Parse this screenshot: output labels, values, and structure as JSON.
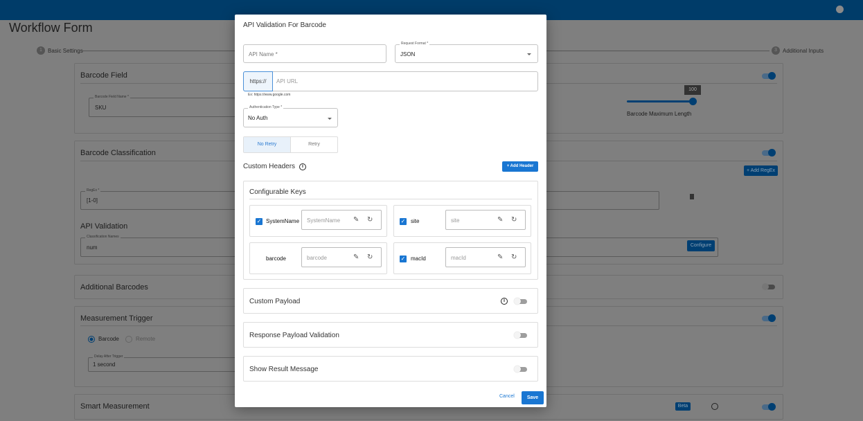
{
  "header": {
    "user_icon": "account-circle-icon"
  },
  "page": {
    "title": "Workflow Form",
    "steps": [
      {
        "num": "1",
        "label": "Basic Settings"
      },
      {
        "num": "3",
        "label": "Additional Inputs"
      }
    ],
    "barcode_field": {
      "title": "Barcode Field",
      "field_label": "Barcode Field Name *",
      "field_value": "SKU",
      "slider_value": "100",
      "slider_label": "Barcode Maximum Length",
      "slider_fraction": 1.0
    },
    "classification": {
      "title": "Barcode Classification",
      "add_regex": "+ Add RegEx",
      "regex_label": "RegEx *",
      "regex_value": "[1-0]",
      "api_title": "API Validation",
      "names_label": "Classification Names",
      "names_value": "num",
      "configure": "Configure"
    },
    "additional_barcodes": {
      "title": "Additional Barcodes"
    },
    "measurement_trigger": {
      "title": "Measurement Trigger",
      "radio_barcode": "Barcode",
      "radio_remote": "Remote",
      "delay_label": "Delay After Trigger",
      "delay_value": "1 second"
    },
    "smart_measurement": {
      "title": "Smart Measurement",
      "badge": "Beta"
    }
  },
  "modal": {
    "title": "API Validation For Barcode",
    "api_name_placeholder": "API Name *",
    "request_format_label": "Request Format *",
    "request_format_value": "JSON",
    "url_prefix": "https://",
    "url_placeholder": "API URL",
    "url_hint": "Ex: https://www.google.com",
    "auth_label": "Authentication Type *",
    "auth_value": "No Auth",
    "retry_options": [
      "No Retry",
      "Retry"
    ],
    "custom_headers": "Custom Headers",
    "add_header": "+ Add Header",
    "configurable_keys": "Configurable Keys",
    "keys": [
      {
        "name": "SystemName",
        "placeholder": "SystemName",
        "checked": true
      },
      {
        "name": "site",
        "placeholder": "site",
        "checked": true
      },
      {
        "name": "barcode",
        "placeholder": "barcode",
        "checked": false
      },
      {
        "name": "macId",
        "placeholder": "macId",
        "checked": true
      }
    ],
    "sections": [
      "Custom Payload",
      "Response Payload Validation",
      "Show Result Message"
    ],
    "cancel": "Cancel",
    "save": "Save"
  }
}
